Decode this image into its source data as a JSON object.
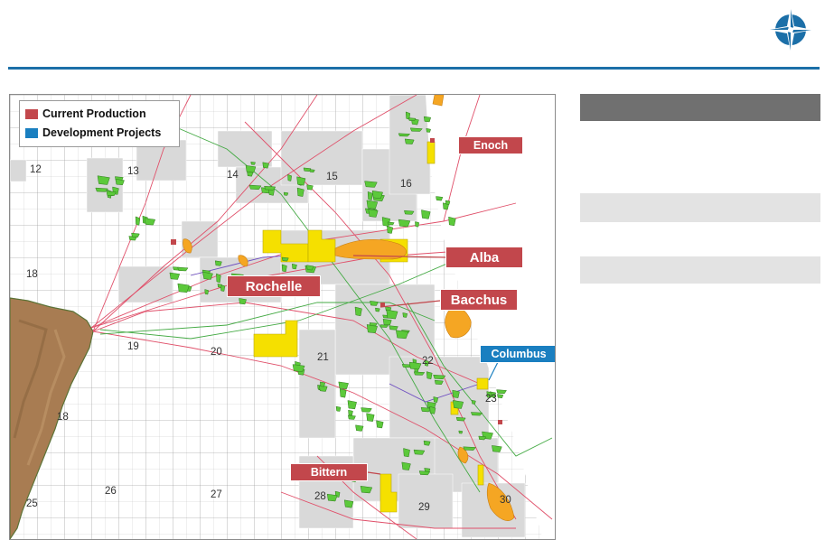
{
  "colors": {
    "accent_blue": "#1b6fa8",
    "production_red": "#c2474c",
    "development_blue": "#1a7fc0",
    "licence_grey": "#d9d9d9",
    "field_green": "#5cc93b",
    "field_yellow": "#f5e000",
    "field_orange": "#f5a623",
    "land_brown": "#a87c52",
    "sidebar_dark": "#707070",
    "sidebar_light": "#e3e3e3"
  },
  "logo": {
    "icon": "compass-star-icon"
  },
  "legend": {
    "current_production": "Current Production",
    "development_projects": "Development Projects"
  },
  "fields": {
    "enoch": "Enoch",
    "alba": "Alba",
    "rochelle": "Rochelle",
    "bacchus": "Bacchus",
    "columbus": "Columbus",
    "bittern": "Bittern"
  },
  "blocks": {
    "b12": "12",
    "b13": "13",
    "b14": "14",
    "b15": "15",
    "b16": "16",
    "b18": "18",
    "b19": "19",
    "b20": "20",
    "b21": "21",
    "b22": "22",
    "b23": "23",
    "b18b": "18",
    "b25": "25",
    "b26": "26",
    "b27": "27",
    "b28": "28",
    "b29": "29",
    "b30": "30"
  }
}
